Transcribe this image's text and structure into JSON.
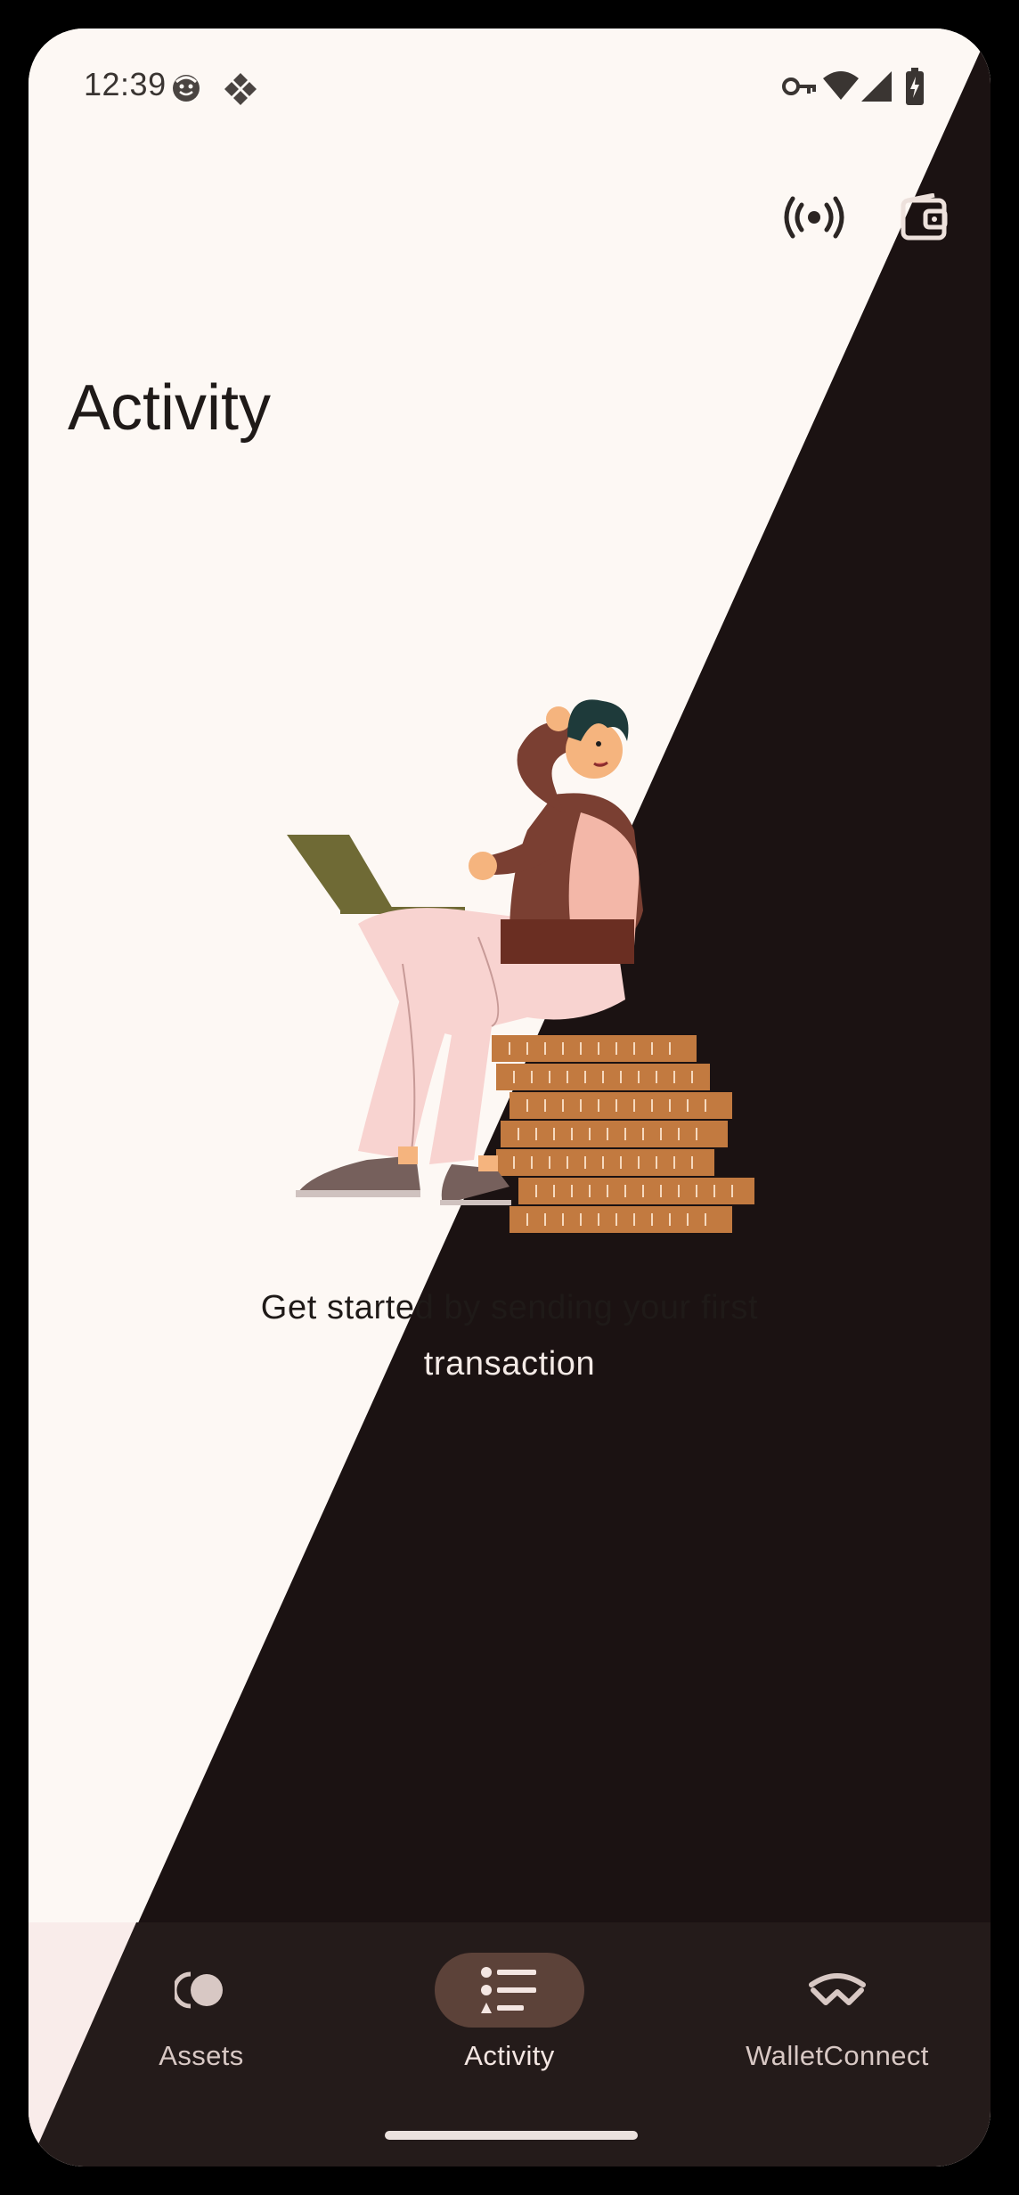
{
  "status_bar": {
    "time": "12:39"
  },
  "top_actions": {
    "broadcast_icon": "broadcast-icon",
    "wallet_icon": "wallet-icon"
  },
  "page": {
    "title": "Activity"
  },
  "empty_state": {
    "message_line1": "Get started by sending your first",
    "message_line2": "transaction"
  },
  "bottom_nav": {
    "items": [
      {
        "label": "Assets",
        "icon": "assets-icon",
        "selected": false
      },
      {
        "label": "Activity",
        "icon": "list-icon",
        "selected": true
      },
      {
        "label": "WalletConnect",
        "icon": "walletconnect-icon",
        "selected": false
      }
    ]
  },
  "colors": {
    "light_bg": "#FDF8F4",
    "dark_bg": "#1B1212",
    "nav_bg": "#241B1A",
    "active_pill": "#5C4239"
  }
}
